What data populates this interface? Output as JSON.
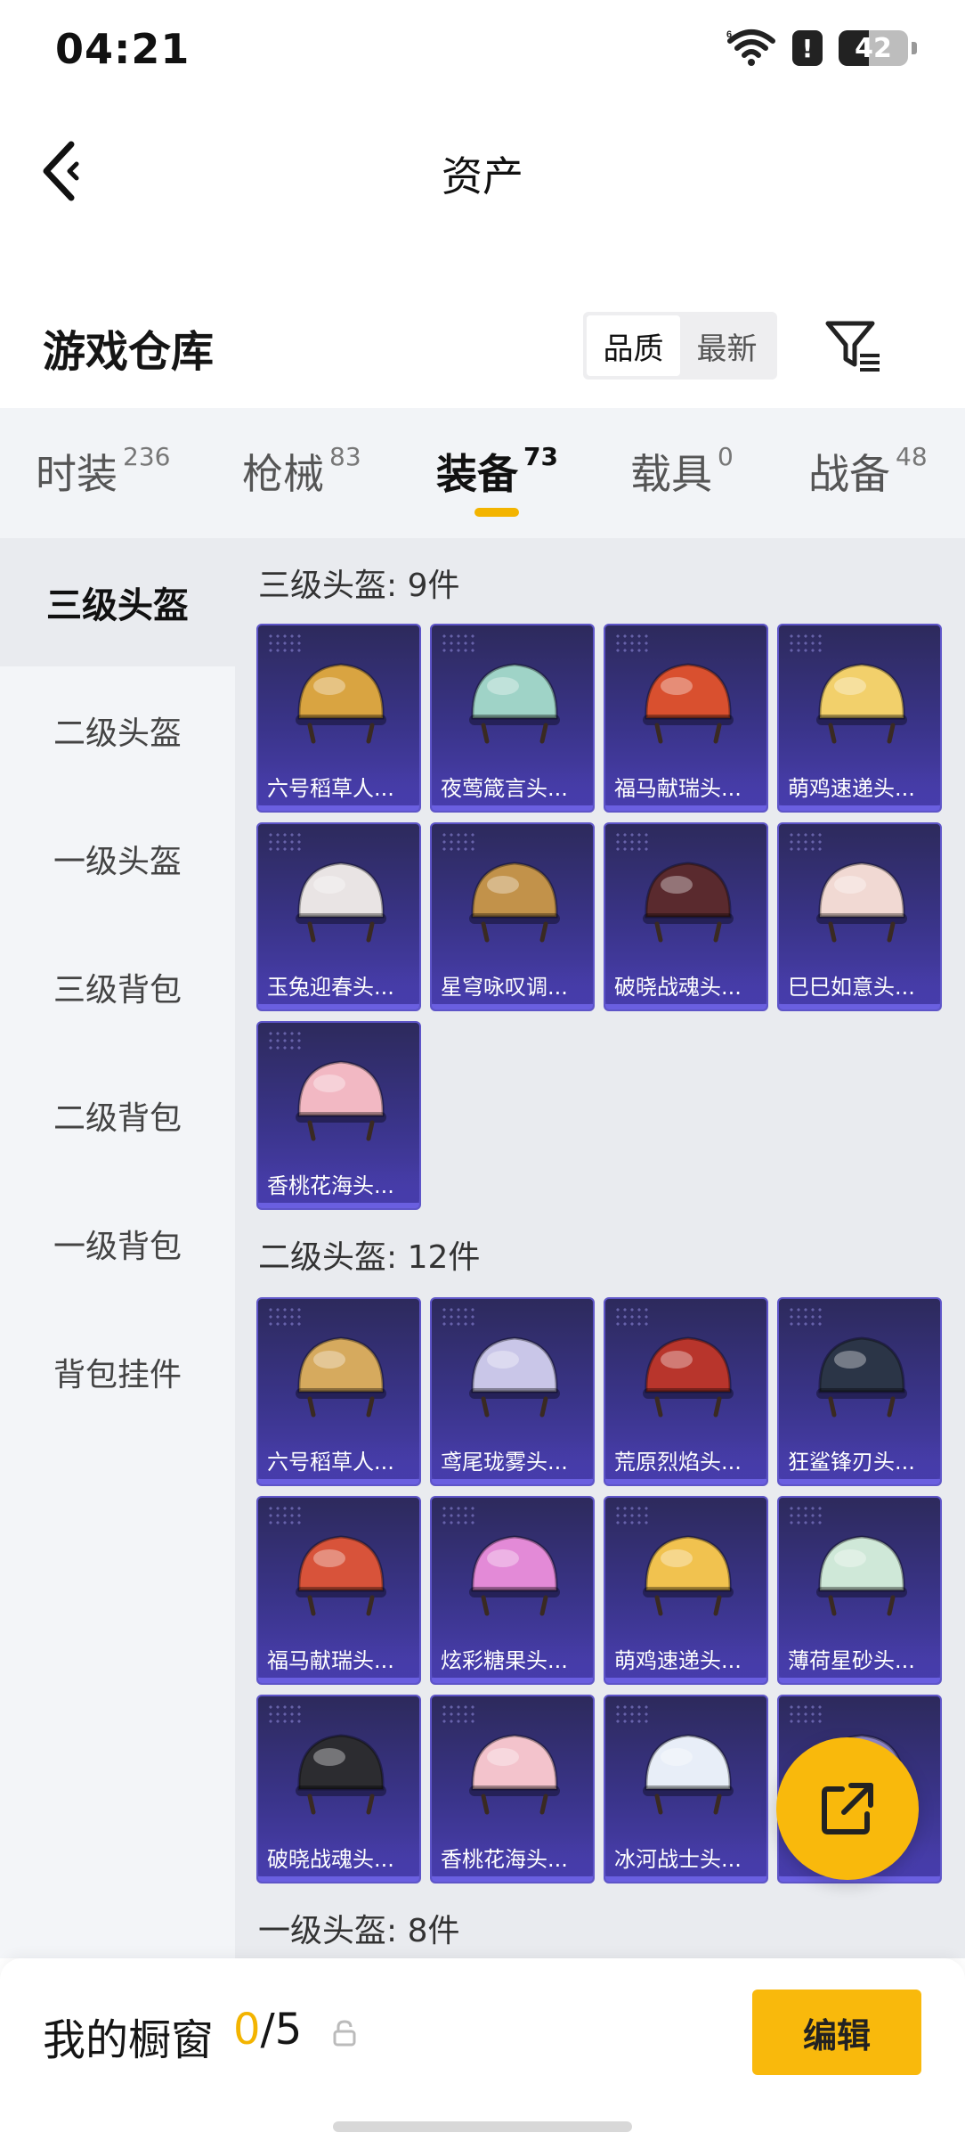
{
  "status_bar": {
    "time": "04:21",
    "battery": "42"
  },
  "header": {
    "title": "资产"
  },
  "warehouse": {
    "title": "游戏仓库",
    "sort_options": [
      "品质",
      "最新"
    ],
    "selected_sort": "品质"
  },
  "tabs": [
    {
      "label": "时装",
      "count": "236"
    },
    {
      "label": "枪械",
      "count": "83"
    },
    {
      "label": "装备",
      "count": "73",
      "active": true
    },
    {
      "label": "载具",
      "count": "0"
    },
    {
      "label": "战备",
      "count": "48"
    }
  ],
  "sidebar": [
    {
      "label": "三级头盔",
      "active": true
    },
    {
      "label": "二级头盔"
    },
    {
      "label": "一级头盔"
    },
    {
      "label": "三级背包"
    },
    {
      "label": "二级背包"
    },
    {
      "label": "一级背包"
    },
    {
      "label": "背包挂件"
    }
  ],
  "sections": [
    {
      "title": "三级头盔: 9件",
      "items": [
        {
          "name": "六号稻草人...",
          "color": "#d9a441"
        },
        {
          "name": "夜莺箴言头...",
          "color": "#9fd3c7"
        },
        {
          "name": "福马献瑞头...",
          "color": "#d9502f"
        },
        {
          "name": "萌鸡速递头...",
          "color": "#f2d06b"
        },
        {
          "name": "玉兔迎春头...",
          "color": "#e9e4e4"
        },
        {
          "name": "星穹咏叹调...",
          "color": "#c2924a"
        },
        {
          "name": "破晓战魂头...",
          "color": "#5a2a2e"
        },
        {
          "name": "巳巳如意头...",
          "color": "#f1d9d3"
        },
        {
          "name": "香桃花海头...",
          "color": "#f2b8c3"
        }
      ]
    },
    {
      "title": "二级头盔: 12件",
      "items": [
        {
          "name": "六号稻草人...",
          "color": "#d6aa5e"
        },
        {
          "name": "鸢尾珑雾头...",
          "color": "#c9c6e8"
        },
        {
          "name": "荒原烈焰头...",
          "color": "#b8352c"
        },
        {
          "name": "狂鲨锋刃头...",
          "color": "#2b3547"
        },
        {
          "name": "福马献瑞头...",
          "color": "#d8533a"
        },
        {
          "name": "炫彩糖果头...",
          "color": "#e38ad7"
        },
        {
          "name": "萌鸡速递头...",
          "color": "#f1c24f"
        },
        {
          "name": "薄荷星砂头...",
          "color": "#cfe8d8"
        },
        {
          "name": "破晓战魂头...",
          "color": "#2c2c30"
        },
        {
          "name": "香桃花海头...",
          "color": "#f3c3cc"
        },
        {
          "name": "冰河战士头...",
          "color": "#e8eef8"
        },
        {
          "name": "",
          "color": "#8f86c8"
        }
      ]
    },
    {
      "title": "一级头盔: 8件",
      "items": []
    }
  ],
  "showcase": {
    "label": "我的橱窗",
    "current": "0",
    "total": "/5",
    "edit_label": "编辑"
  }
}
